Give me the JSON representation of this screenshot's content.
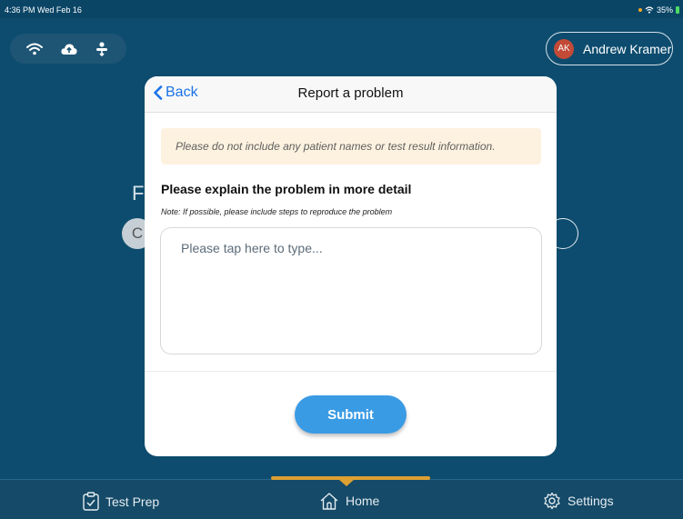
{
  "status_bar": {
    "time": "4:36 PM  Wed Feb 16",
    "battery": "35%"
  },
  "top_icons": [
    "wifi-icon",
    "cloud-upload-icon",
    "network-icon"
  ],
  "user": {
    "initials": "AK",
    "name": "Andrew Kramer",
    "avatar_color": "#c24a37"
  },
  "background_partial": {
    "letter": "F",
    "circle_letter": "C"
  },
  "modal": {
    "back_label": "Back",
    "title": "Report a problem",
    "warning": "Please do not include any patient names or test result information.",
    "detail_heading": "Please explain the problem in more detail",
    "note": "Note: If possible, please include steps to reproduce the problem",
    "textarea_placeholder": "Please tap here to type...",
    "submit_label": "Submit"
  },
  "tabs": [
    {
      "label": "Test Prep",
      "icon": "clipboard-check-icon",
      "active": false
    },
    {
      "label": "Home",
      "icon": "home-icon",
      "active": true
    },
    {
      "label": "Settings",
      "icon": "gear-icon",
      "active": false
    }
  ],
  "colors": {
    "background": "#0d4c6e",
    "accent": "#3a9be5",
    "active_tab": "#dca033",
    "warning_bg": "#fdf2df"
  }
}
